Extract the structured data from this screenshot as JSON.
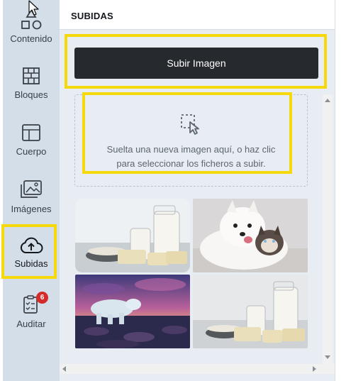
{
  "sidebar": {
    "items": [
      {
        "label": "Contenido",
        "icon": "shapes-icon"
      },
      {
        "label": "Bloques",
        "icon": "brick-wall-icon"
      },
      {
        "label": "Cuerpo",
        "icon": "layout-icon"
      },
      {
        "label": "Imágenes",
        "icon": "images-icon"
      },
      {
        "label": "Subidas",
        "icon": "cloud-upload-icon",
        "active": true
      },
      {
        "label": "Auditar",
        "icon": "clipboard-check-icon",
        "badge": "6"
      }
    ]
  },
  "panel": {
    "title": "SUBIDAS",
    "upload_button": "Subir Imagen",
    "dropzone_text": "Suelta una nueva imagen aquí, o haz clic para seleccionar los ficheros a subir."
  },
  "gallery": [
    {
      "subject": "milk-and-cheese"
    },
    {
      "subject": "white-dog-with-cat"
    },
    {
      "subject": "polar-bear-on-shore"
    },
    {
      "subject": "milk-jugs-and-cheese"
    }
  ],
  "colors": {
    "sidebar_bg": "#d3dee8",
    "panel_bg": "#e8edf3",
    "button_bg": "#26292d",
    "highlight": "#f5d90a",
    "badge": "#d42b2b"
  }
}
